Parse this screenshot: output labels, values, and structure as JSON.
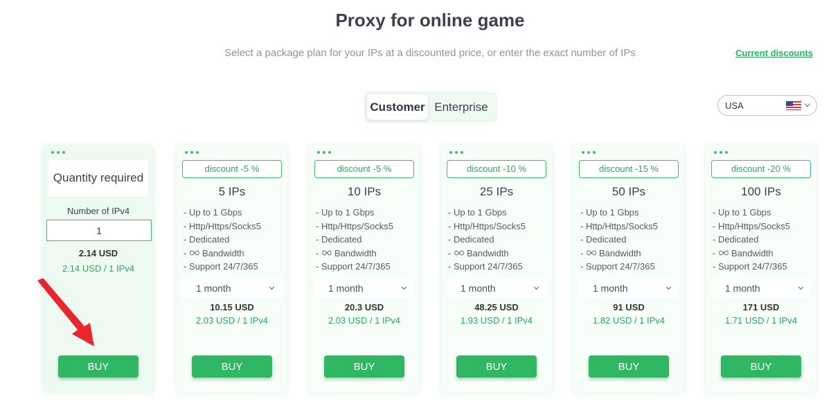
{
  "header": {
    "title": "Proxy for online game",
    "subtitle": "Select a package plan for your IPs at a discounted price, or enter the exact number of IPs",
    "discounts_link": "Current discounts"
  },
  "switcher": {
    "customer": "Customer",
    "enterprise": "Enterprise",
    "active": "Customer"
  },
  "country": {
    "value": "USA",
    "flag_icon": "us-flag-icon"
  },
  "custom_card": {
    "title": "Quantity required",
    "quantity_label": "Number of IPv4",
    "quantity_value": "1",
    "price": "2.14 USD",
    "unit_price": "2.14 USD / 1 IPv4",
    "buy_label": "BUY"
  },
  "features": [
    "- Up to 1 Gbps",
    "- Http/Https/Socks5",
    "- Dedicated",
    "Bandwidth",
    "- Support 24/7/365"
  ],
  "plans": [
    {
      "discount": "discount -5 %",
      "title": "5 IPs",
      "term": "1 month",
      "price": "10.15 USD",
      "unit_price": "2.03 USD / 1 IPv4",
      "buy_label": "BUY"
    },
    {
      "discount": "discount -5 %",
      "title": "10 IPs",
      "term": "1 month",
      "price": "20.3 USD",
      "unit_price": "2.03 USD / 1 IPv4",
      "buy_label": "BUY"
    },
    {
      "discount": "discount -10 %",
      "title": "25 IPs",
      "term": "1 month",
      "price": "48.25 USD",
      "unit_price": "1.93 USD / 1 IPv4",
      "buy_label": "BUY"
    },
    {
      "discount": "discount -15 %",
      "title": "50 IPs",
      "term": "1 month",
      "price": "91 USD",
      "unit_price": "1.82 USD / 1 IPv4",
      "buy_label": "BUY"
    },
    {
      "discount": "discount -20 %",
      "title": "100 IPs",
      "term": "1 month",
      "price": "171 USD",
      "unit_price": "1.71 USD / 1 IPv4",
      "buy_label": "BUY"
    }
  ],
  "colors": {
    "accent": "#2fb764",
    "annotation_arrow": "#e8262b"
  }
}
